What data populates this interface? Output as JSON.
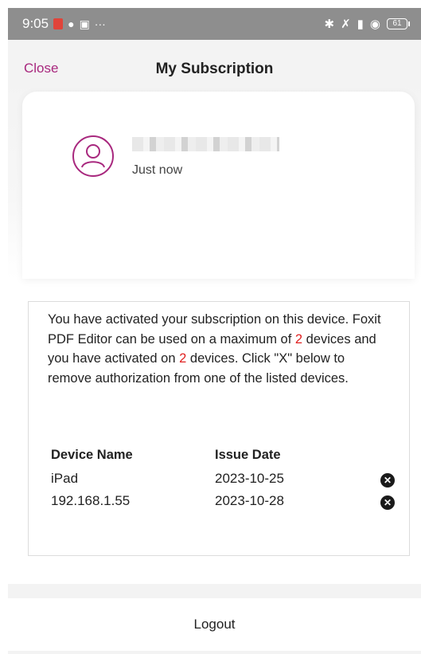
{
  "status_bar": {
    "time": "9:05",
    "more": "···",
    "battery": "61",
    "icons": [
      "notification-red-icon",
      "chat-bubble-icon",
      "shop-bag-icon",
      "bluetooth-icon",
      "mute-icon",
      "signal-icon",
      "wifi-icon",
      "battery-icon"
    ]
  },
  "header": {
    "close_label": "Close",
    "title": "My Subscription",
    "accent_color": "#a8287e"
  },
  "profile": {
    "last_login": "Just now"
  },
  "info": {
    "line1": "You have activated your subscription on this device. Foxit PDF Editor can be used on a maximum of ",
    "max_devices": "2",
    "line2": " devices and you have activated on ",
    "activated_devices": "2",
    "line3": " devices. Click \"X\" below to remove authorization from one of the listed devices."
  },
  "devices": {
    "col_name": "Device Name",
    "col_date": "Issue Date",
    "rows": [
      {
        "name": "iPad",
        "date": "2023-10-25",
        "remove": "✕"
      },
      {
        "name": "192.168.1.55",
        "date": "2023-10-28",
        "remove": "✕"
      }
    ]
  },
  "logout_label": "Logout"
}
